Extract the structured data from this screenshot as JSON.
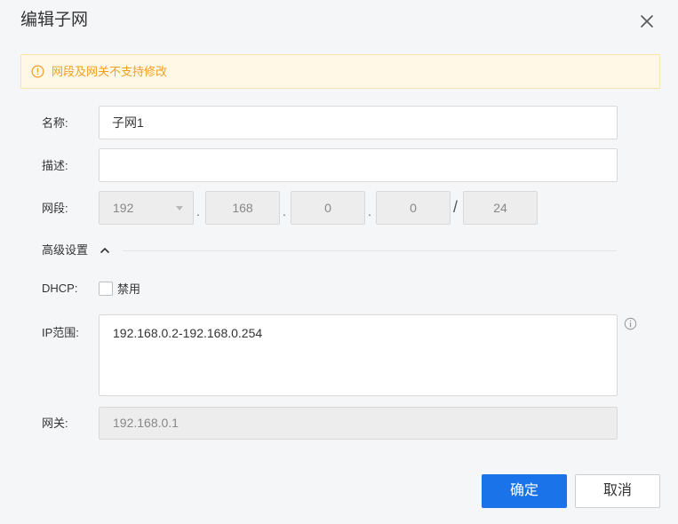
{
  "dialog": {
    "title": "编辑子网"
  },
  "alert": {
    "text": "网段及网关不支持修改",
    "color": "#f0a020"
  },
  "form": {
    "name_label": "名称:",
    "name_value": "子网1",
    "desc_label": "描述:",
    "desc_value": "",
    "segment_label": "网段:",
    "segment": {
      "octet1": "192",
      "octet2": "168",
      "octet3": "0",
      "octet4": "0",
      "dot": ".",
      "slash": "/",
      "prefix": "24"
    },
    "advanced_label": "高级设置",
    "dhcp_label": "DHCP:",
    "dhcp_option": "禁用",
    "dhcp_checked": false,
    "ip_range_label": "IP范围:",
    "ip_range_value": "192.168.0.2-192.168.0.254",
    "gateway_label": "网关:",
    "gateway_value": "192.168.0.1"
  },
  "buttons": {
    "confirm": "确定",
    "cancel": "取消"
  },
  "colors": {
    "primary": "#1a73e8",
    "background": "#f5f6f8",
    "warning": "#f0a020"
  }
}
